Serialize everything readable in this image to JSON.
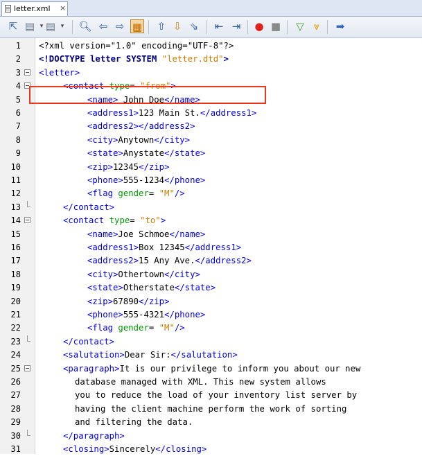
{
  "tab": {
    "label": "letter.xml",
    "close": "×"
  },
  "toolbar": {
    "buttons": [
      "back-icon",
      "forward-icon",
      "find-icon",
      "find-prev-icon",
      "find-next-icon",
      "toggle-highlight-icon",
      "prev-bookmark-icon",
      "next-bookmark-icon",
      "toggle-bookmark-icon",
      "shift-left-icon",
      "shift-right-icon",
      "record-macro-icon",
      "stop-macro-icon",
      "validate-icon",
      "check-icon",
      "download-icon"
    ]
  },
  "lines": [
    {
      "n": "1",
      "indent": 0,
      "parts": [
        [
          "pi",
          "<?xml version=\"1.0\" encoding=\"UTF-8\"?>"
        ]
      ]
    },
    {
      "n": "2",
      "indent": 0,
      "parts": [
        [
          "bold",
          "<!DOCTYPE letter SYSTEM "
        ],
        [
          "val",
          "\"letter.dtd\""
        ],
        [
          "bold",
          ">"
        ]
      ]
    },
    {
      "n": "3",
      "indent": 0,
      "parts": [
        [
          "tag",
          "<letter>"
        ]
      ]
    },
    {
      "n": "4",
      "indent": 1,
      "parts": [
        [
          "tag",
          "<contact "
        ],
        [
          "attr",
          "type"
        ],
        [
          "",
          "= "
        ],
        [
          "val",
          "\"from\""
        ],
        [
          "tag",
          ">"
        ]
      ]
    },
    {
      "n": "5",
      "indent": 2,
      "parts": [
        [
          "tag",
          "<name>"
        ],
        [
          "",
          " John Doe"
        ],
        [
          "tag",
          "</name>"
        ]
      ]
    },
    {
      "n": "6",
      "indent": 2,
      "parts": [
        [
          "tag",
          "<address1>"
        ],
        [
          "",
          "123 Main St."
        ],
        [
          "tag",
          "</address1>"
        ]
      ]
    },
    {
      "n": "7",
      "indent": 2,
      "parts": [
        [
          "tag",
          "<address2></address2>"
        ]
      ]
    },
    {
      "n": "8",
      "indent": 2,
      "parts": [
        [
          "tag",
          "<city>"
        ],
        [
          "",
          "Anytown"
        ],
        [
          "tag",
          "</city>"
        ]
      ]
    },
    {
      "n": "9",
      "indent": 2,
      "parts": [
        [
          "tag",
          "<state>"
        ],
        [
          "",
          "Anystate"
        ],
        [
          "tag",
          "</state>"
        ]
      ]
    },
    {
      "n": "10",
      "indent": 2,
      "parts": [
        [
          "tag",
          "<zip>"
        ],
        [
          "",
          "12345"
        ],
        [
          "tag",
          "</zip>"
        ]
      ]
    },
    {
      "n": "11",
      "indent": 2,
      "parts": [
        [
          "tag",
          "<phone>"
        ],
        [
          "",
          "555-1234"
        ],
        [
          "tag",
          "</phone>"
        ]
      ]
    },
    {
      "n": "12",
      "indent": 2,
      "parts": [
        [
          "tag",
          "<flag "
        ],
        [
          "attr",
          "gender"
        ],
        [
          "",
          "= "
        ],
        [
          "val",
          "\"M\""
        ],
        [
          "tag",
          "/>"
        ]
      ]
    },
    {
      "n": "13",
      "indent": 1,
      "parts": [
        [
          "tag",
          "</contact>"
        ]
      ]
    },
    {
      "n": "14",
      "indent": 1,
      "parts": [
        [
          "tag",
          "<contact "
        ],
        [
          "attr",
          "type"
        ],
        [
          "",
          "= "
        ],
        [
          "val",
          "\"to\""
        ],
        [
          "tag",
          ">"
        ]
      ]
    },
    {
      "n": "15",
      "indent": 2,
      "parts": [
        [
          "tag",
          "<name>"
        ],
        [
          "",
          "Joe Schmoe"
        ],
        [
          "tag",
          "</name>"
        ]
      ]
    },
    {
      "n": "16",
      "indent": 2,
      "parts": [
        [
          "tag",
          "<address1>"
        ],
        [
          "",
          "Box 12345"
        ],
        [
          "tag",
          "</address1>"
        ]
      ]
    },
    {
      "n": "17",
      "indent": 2,
      "parts": [
        [
          "tag",
          "<address2>"
        ],
        [
          "",
          "15 Any Ave."
        ],
        [
          "tag",
          "</address2>"
        ]
      ]
    },
    {
      "n": "18",
      "indent": 2,
      "parts": [
        [
          "tag",
          "<city>"
        ],
        [
          "",
          "Othertown"
        ],
        [
          "tag",
          "</city>"
        ]
      ]
    },
    {
      "n": "19",
      "indent": 2,
      "parts": [
        [
          "tag",
          "<state>"
        ],
        [
          "",
          "Otherstate"
        ],
        [
          "tag",
          "</state>"
        ]
      ]
    },
    {
      "n": "20",
      "indent": 2,
      "parts": [
        [
          "tag",
          "<zip>"
        ],
        [
          "",
          "67890"
        ],
        [
          "tag",
          "</zip>"
        ]
      ]
    },
    {
      "n": "21",
      "indent": 2,
      "parts": [
        [
          "tag",
          "<phone>"
        ],
        [
          "",
          "555-4321"
        ],
        [
          "tag",
          "</phone>"
        ]
      ]
    },
    {
      "n": "22",
      "indent": 2,
      "parts": [
        [
          "tag",
          "<flag "
        ],
        [
          "attr",
          "gender"
        ],
        [
          "",
          "= "
        ],
        [
          "val",
          "\"M\""
        ],
        [
          "tag",
          "/>"
        ]
      ]
    },
    {
      "n": "23",
      "indent": 1,
      "parts": [
        [
          "tag",
          "</contact>"
        ]
      ]
    },
    {
      "n": "24",
      "indent": 1,
      "parts": [
        [
          "tag",
          "<salutation>"
        ],
        [
          "",
          "Dear Sir:"
        ],
        [
          "tag",
          "</salutation>"
        ]
      ]
    },
    {
      "n": "25",
      "indent": 1,
      "parts": [
        [
          "tag",
          "<paragraph>"
        ],
        [
          "",
          "It is our privilege to inform you about our new"
        ]
      ]
    },
    {
      "n": "26",
      "indent": 1.5,
      "parts": [
        [
          "",
          "database managed with XML. This new system allows"
        ]
      ]
    },
    {
      "n": "27",
      "indent": 1.5,
      "parts": [
        [
          "",
          "you to reduce the load of your inventory list server by"
        ]
      ]
    },
    {
      "n": "28",
      "indent": 1.5,
      "parts": [
        [
          "",
          "having the client machine perform the work of sorting"
        ]
      ]
    },
    {
      "n": "29",
      "indent": 1.5,
      "parts": [
        [
          "",
          "and filtering the data."
        ]
      ]
    },
    {
      "n": "30",
      "indent": 1,
      "parts": [
        [
          "tag",
          "</paragraph>"
        ]
      ]
    },
    {
      "n": "31",
      "indent": 1,
      "parts": [
        [
          "tag",
          "<closing>"
        ],
        [
          "",
          "Sincerely"
        ],
        [
          "tag",
          "</closing>"
        ]
      ]
    }
  ],
  "folds": {
    "open": [
      "3",
      "4",
      "14",
      "25"
    ],
    "close": [
      "13",
      "23",
      "30"
    ]
  }
}
